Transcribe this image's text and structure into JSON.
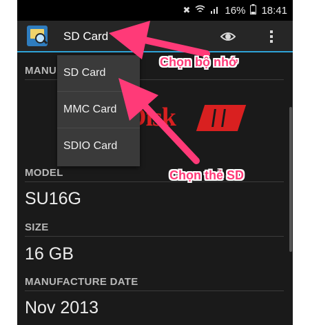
{
  "status_bar": {
    "icons": [
      "mute-icon",
      "wifi-icon",
      "signal-icon"
    ],
    "battery": "16%",
    "time": "18:41"
  },
  "action_bar": {
    "title": "SD Card",
    "icons": [
      "app-icon",
      "eye-icon",
      "overflow-menu-icon"
    ]
  },
  "dropdown": {
    "items": [
      "SD Card",
      "MMC Card",
      "SDIO Card"
    ]
  },
  "details": {
    "manufacturer_label": "MANUFACTURER",
    "manufacturer_logo_text": "Disk",
    "model_label": "MODEL",
    "model_value": "SU16G",
    "size_label": "SIZE",
    "size_value": "16 GB",
    "date_label": "MANUFACTURE DATE",
    "date_value": "Nov 2013"
  },
  "annotations": {
    "choose_memory": "Chọn bộ nhớ",
    "choose_sd_card": "Chọn thẻ SD",
    "color": "#ff3a78"
  },
  "colors": {
    "accent": "#2fa4d8",
    "brand_red": "#d92020"
  }
}
